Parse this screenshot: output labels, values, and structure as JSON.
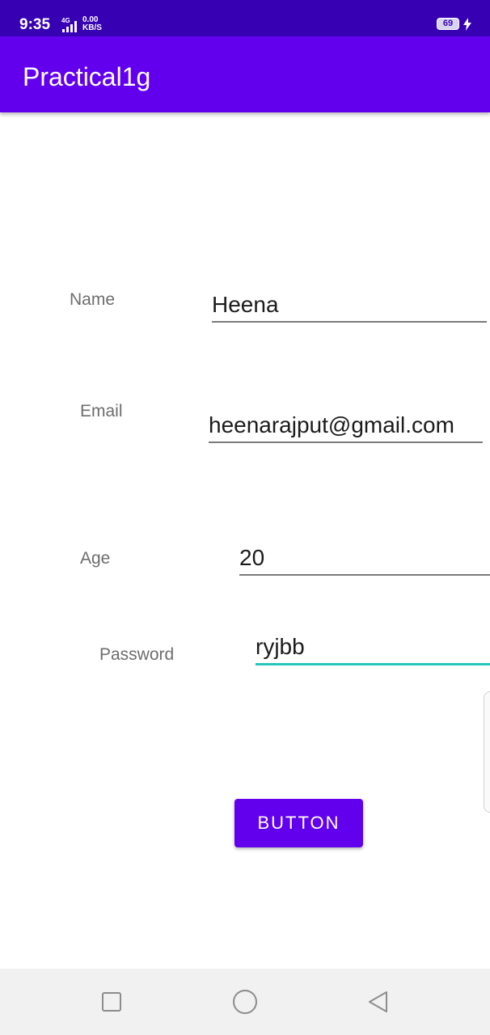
{
  "status_bar": {
    "time": "9:35",
    "network": "4G",
    "speed_value": "0.00",
    "speed_unit": "KB/S",
    "battery_level": "69",
    "signal_icon": "signal-bars-icon",
    "charging_icon": "charging-bolt-icon"
  },
  "app_bar": {
    "title": "Practical1g"
  },
  "form": {
    "name": {
      "label": "Name",
      "value": "Heena"
    },
    "email": {
      "label": "Email",
      "value": "heenarajput@gmail.com"
    },
    "age": {
      "label": "Age",
      "value": "20"
    },
    "password": {
      "label": "Password",
      "value": "ryjbb"
    }
  },
  "button": {
    "label": "BUTTON"
  },
  "nav_bar": {
    "recents_icon": "square-recents-icon",
    "home_icon": "circle-home-icon",
    "back_icon": "triangle-back-icon"
  },
  "colors": {
    "status_bar": "#3700b3",
    "primary": "#6200ee",
    "focus_underline": "#24c6bc",
    "label_text": "#6d6d6d"
  }
}
